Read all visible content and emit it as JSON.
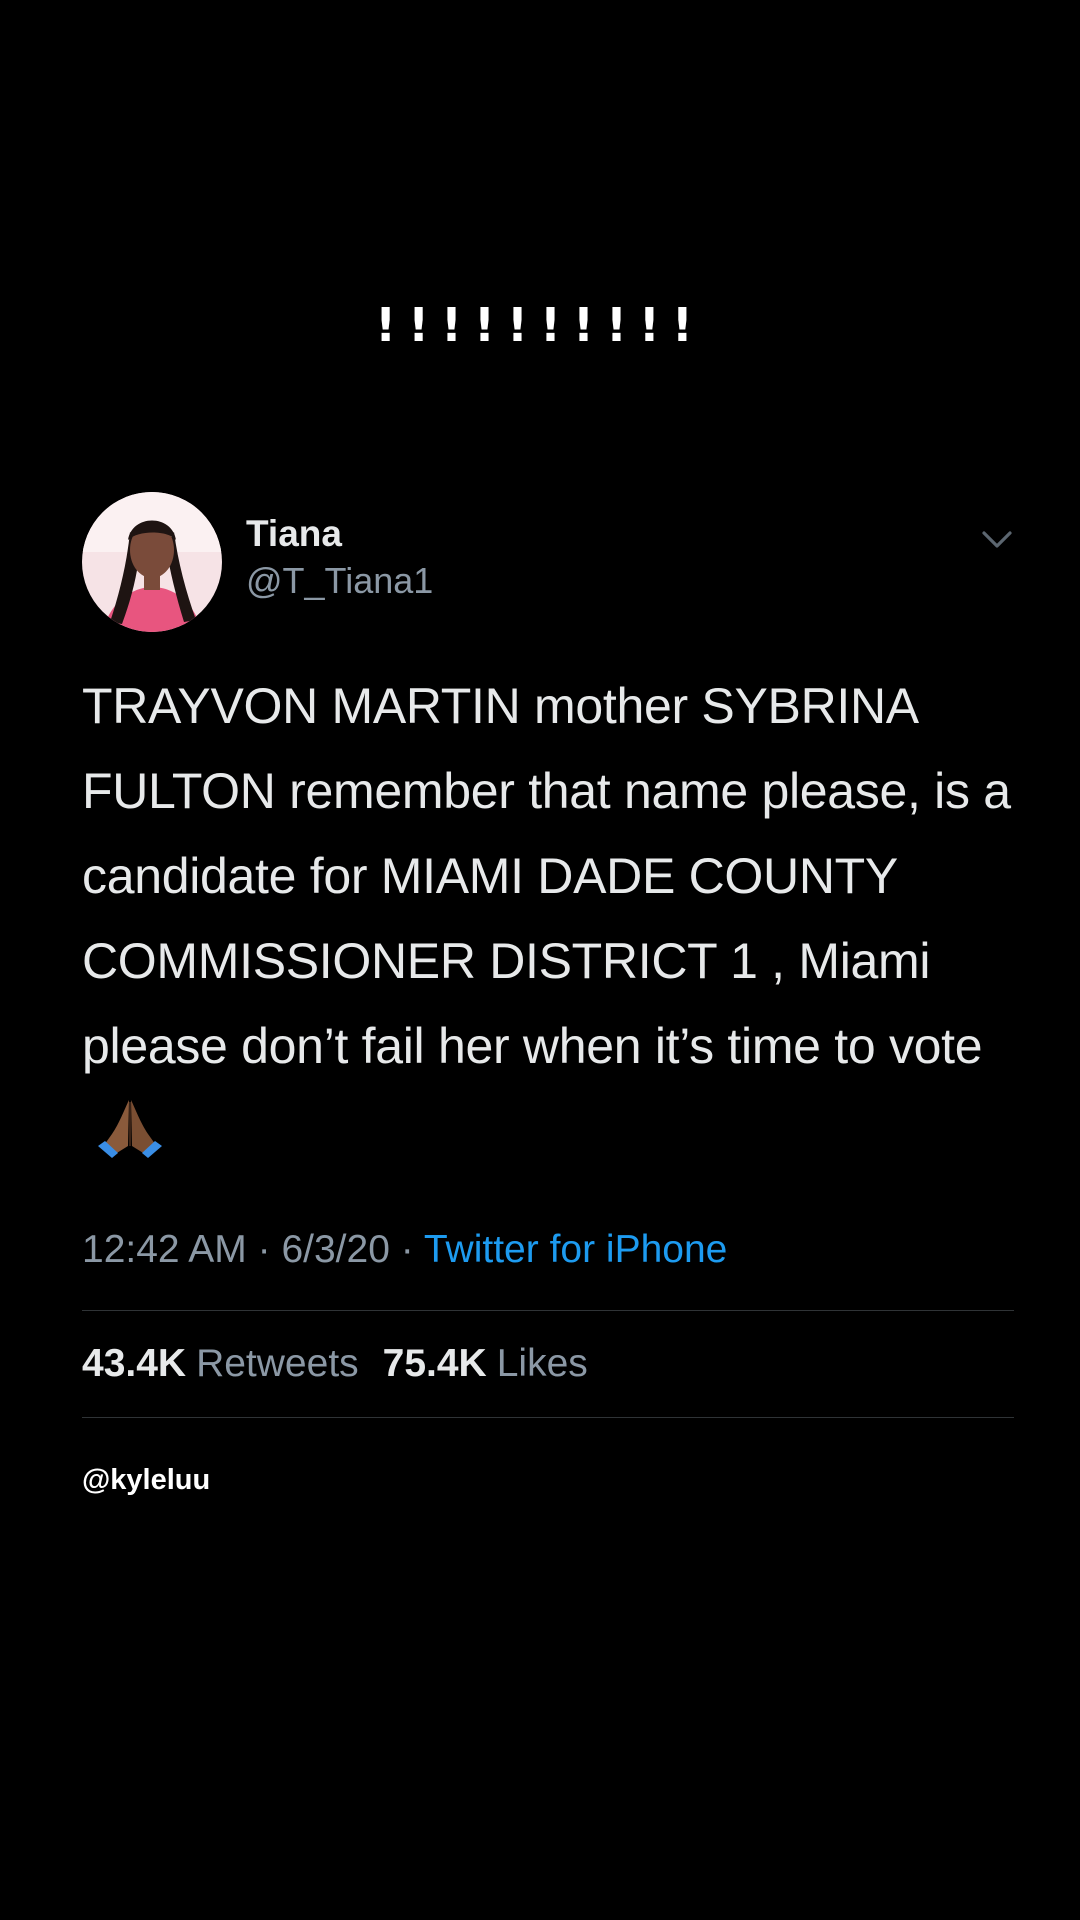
{
  "caption": "!!!!!!!!!!",
  "tweet": {
    "author": {
      "display_name": "Tiana",
      "handle": "@T_Tiana1"
    },
    "menu_icon": "chevron-down-icon",
    "text": "TRAYVON MARTIN mother SYBRINA FULTON remember that name please,  is a candidate for MIAMI DADE COUNTY COMMISSIONER DISTRICT 1 , Miami please don’t fail her when it’s time to vote",
    "emoji": "folded-hands-emoji",
    "time": "12:42 AM",
    "date": "6/3/20",
    "separator": "·",
    "source": "Twitter for iPhone",
    "retweets_count": "43.4K",
    "retweets_label": "Retweets",
    "likes_count": "75.4K",
    "likes_label": "Likes"
  },
  "watermark": "@kyleluu",
  "colors": {
    "background": "#000000",
    "text": "#e7e9ea",
    "secondary": "#8b98a5",
    "link": "#1d9bf0",
    "divider": "#2f3336"
  }
}
